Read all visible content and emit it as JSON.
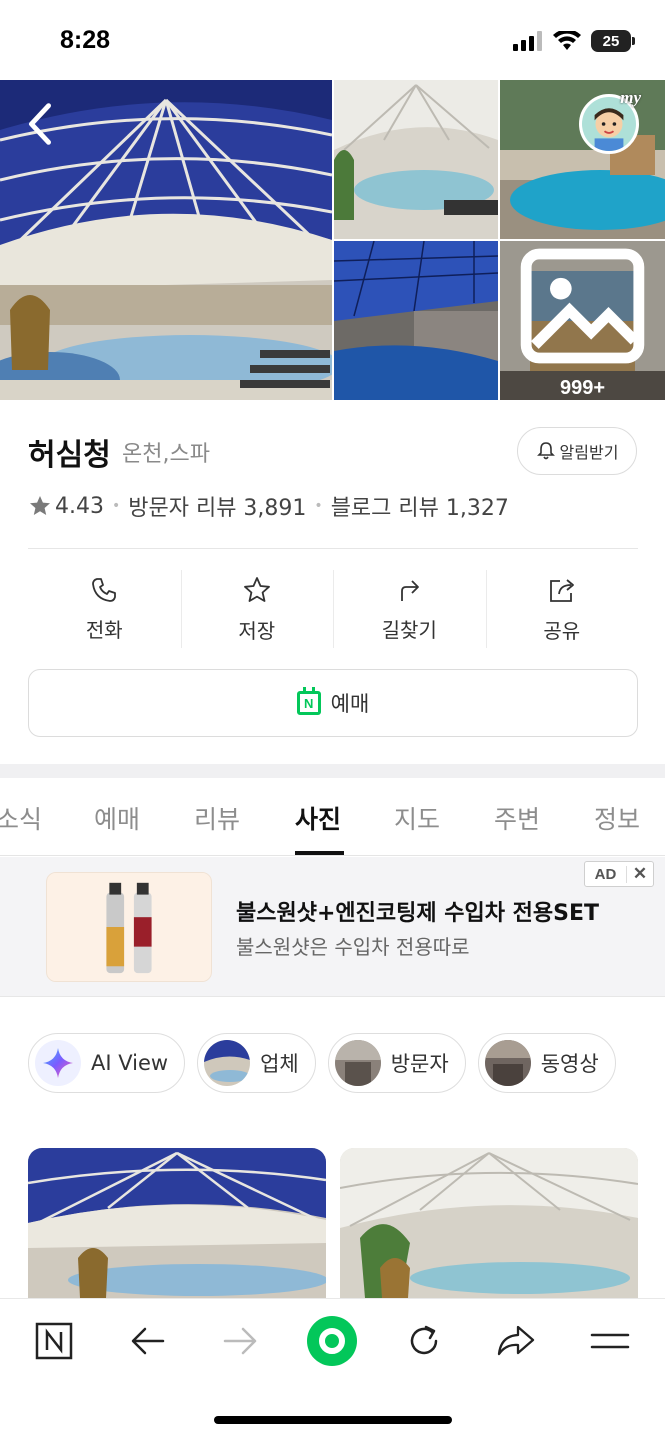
{
  "status_bar": {
    "time": "8:28",
    "battery": "25"
  },
  "photos": {
    "more_count": "999+",
    "my_tag": "my"
  },
  "place": {
    "name": "허심청",
    "category": "온천,스파",
    "alarm_label": "알림받기",
    "rating": "4.43",
    "visitor_reviews": "방문자 리뷰 3,891",
    "blog_reviews": "블로그 리뷰 1,327"
  },
  "actions": [
    {
      "label": "전화",
      "icon": "phone-icon"
    },
    {
      "label": "저장",
      "icon": "star-icon"
    },
    {
      "label": "길찾기",
      "icon": "directions-icon"
    },
    {
      "label": "공유",
      "icon": "share-icon"
    }
  ],
  "reserve": {
    "label": "예매",
    "badge": "N"
  },
  "tabs": [
    {
      "label": "소식",
      "active": false
    },
    {
      "label": "예매",
      "active": false
    },
    {
      "label": "리뷰",
      "active": false
    },
    {
      "label": "사진",
      "active": true
    },
    {
      "label": "지도",
      "active": false
    },
    {
      "label": "주변",
      "active": false
    },
    {
      "label": "정보",
      "active": false
    }
  ],
  "ad": {
    "badge": "AD",
    "close": "✕",
    "title": "불스원샷+엔진코팅제 수입차 전용SET",
    "description": "불스원샷은 수입차 전용따로"
  },
  "filter_chips": [
    {
      "label": "AI View"
    },
    {
      "label": "업체"
    },
    {
      "label": "방문자"
    },
    {
      "label": "동영상"
    }
  ],
  "bottom_nav": [
    {
      "icon": "naver-home-icon"
    },
    {
      "icon": "back-arrow-icon"
    },
    {
      "icon": "forward-arrow-icon"
    },
    {
      "icon": "green-dot-icon"
    },
    {
      "icon": "refresh-icon"
    },
    {
      "icon": "share-arrow-icon"
    },
    {
      "icon": "menu-icon"
    }
  ],
  "colors": {
    "accent": "#03c75a",
    "text": "#222222",
    "muted": "#8d8d8d"
  }
}
